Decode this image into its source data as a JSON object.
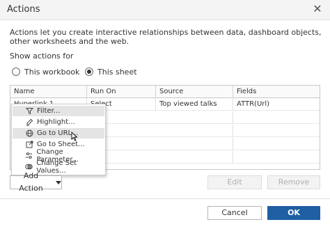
{
  "window": {
    "title": "Actions",
    "close_glyph": "✕"
  },
  "description": "Actions let you create interactive relationships between data, dashboard objects, other worksheets and the web.",
  "show_actions_label": "Show actions for",
  "radios": [
    {
      "label": "This workbook",
      "selected": false
    },
    {
      "label": "This sheet",
      "selected": true
    }
  ],
  "table": {
    "columns": [
      "Name",
      "Run On",
      "Source",
      "Fields"
    ],
    "rows": [
      {
        "name": "Hyperlink 1",
        "run_on": "Select",
        "source": "Top viewed talks",
        "fields": "ATTR(Url)"
      }
    ]
  },
  "add_action_menu": {
    "items": [
      {
        "label": "Filter...",
        "icon": "filter-icon",
        "hovered": true
      },
      {
        "label": "Highlight...",
        "icon": "highlight-icon",
        "hovered": false
      },
      {
        "label": "Go to URL...",
        "icon": "globe-icon",
        "hovered": true
      },
      {
        "label": "Go to Sheet...",
        "icon": "go-to-sheet-icon",
        "hovered": false
      },
      {
        "label": "Change Parameter...",
        "icon": "parameter-icon",
        "hovered": false
      },
      {
        "label": "Change Set Values...",
        "icon": "set-values-icon",
        "hovered": false
      }
    ]
  },
  "buttons": {
    "add_action": "Add Action",
    "edit": "Edit",
    "remove": "Remove",
    "cancel": "Cancel",
    "ok": "OK"
  },
  "colors": {
    "primary": "#1f5fa3",
    "menu_hover": "#e4e4e4"
  }
}
